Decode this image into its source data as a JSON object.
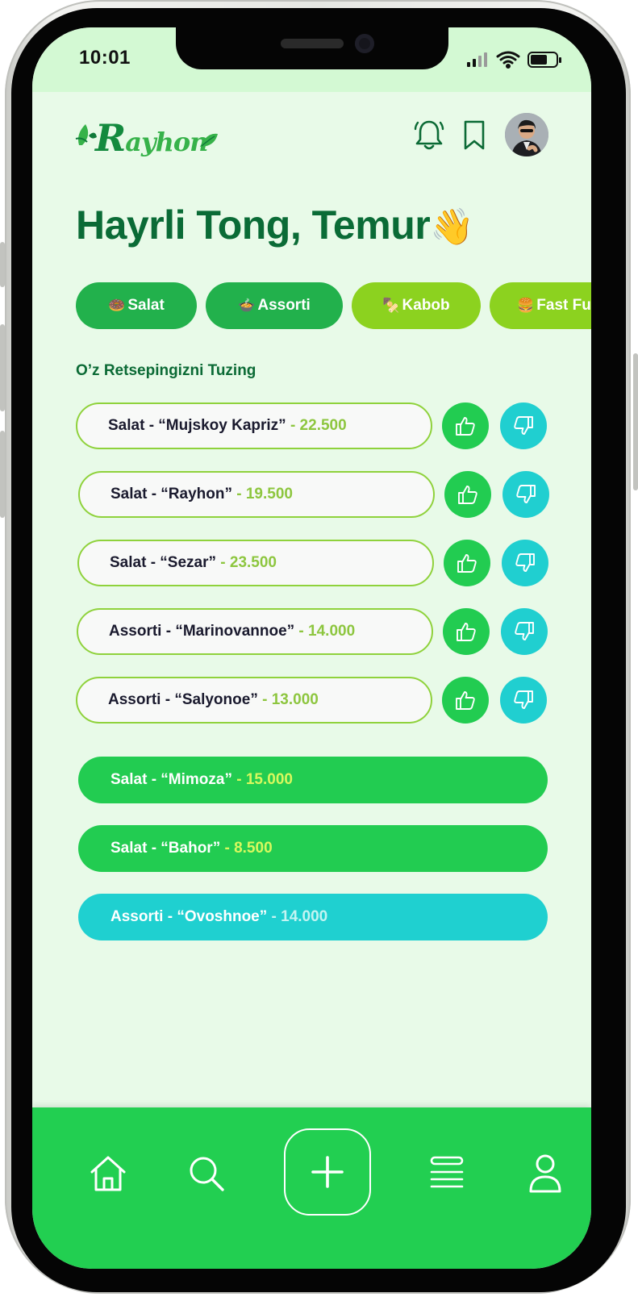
{
  "status": {
    "time": "10:01"
  },
  "brand": {
    "logo_initial": "R",
    "logo_rest": "ayhon"
  },
  "header": {
    "greeting": "Hayrli Tong, Temur",
    "greeting_emoji": "👋"
  },
  "categories": [
    {
      "emoji": "🍩",
      "label": "Salat",
      "color": "#22b14c"
    },
    {
      "emoji": "🍲",
      "label": "Assorti",
      "color": "#22b14c"
    },
    {
      "emoji": "🍢",
      "label": "Kabob",
      "color": "#8cd21f"
    },
    {
      "emoji": "🍔",
      "label": "Fast Fu",
      "color": "#8cd21f"
    }
  ],
  "section": {
    "title": "O’z Retsepingizni Tuzing"
  },
  "recipes": [
    {
      "name": "Salat - “Mujskoy Kapriz”",
      "price": " - 22.500"
    },
    {
      "name": "Salat - “Rayhon”",
      "price": " - 19.500"
    },
    {
      "name": "Salat - “Sezar”",
      "price": " - 23.500"
    },
    {
      "name": "Assorti - “Marinovannoe”",
      "price": " - 14.000"
    },
    {
      "name": "Assorti - “Salyonoe”",
      "price": " - 13.000"
    }
  ],
  "selected": [
    {
      "name": "Salat - “Mimoza”",
      "price": " - 15.000",
      "color": "#22cc51"
    },
    {
      "name": "Salat - “Bahor”",
      "price": " - 8.500",
      "color": "#22cc51"
    },
    {
      "name": "Assorti - “Ovoshnoe”",
      "price": " - 14.000",
      "color": "#1fd0d0"
    }
  ],
  "colors": {
    "like": "#22cc51",
    "dislike": "#20cfd0",
    "nav": "#22cf51",
    "outline": "#8fd23c"
  },
  "icons": {
    "header": [
      "bell-icon",
      "bookmark-icon",
      "avatar"
    ],
    "nav": [
      "home-icon",
      "search-icon",
      "plus-icon",
      "list-icon",
      "user-icon"
    ]
  }
}
